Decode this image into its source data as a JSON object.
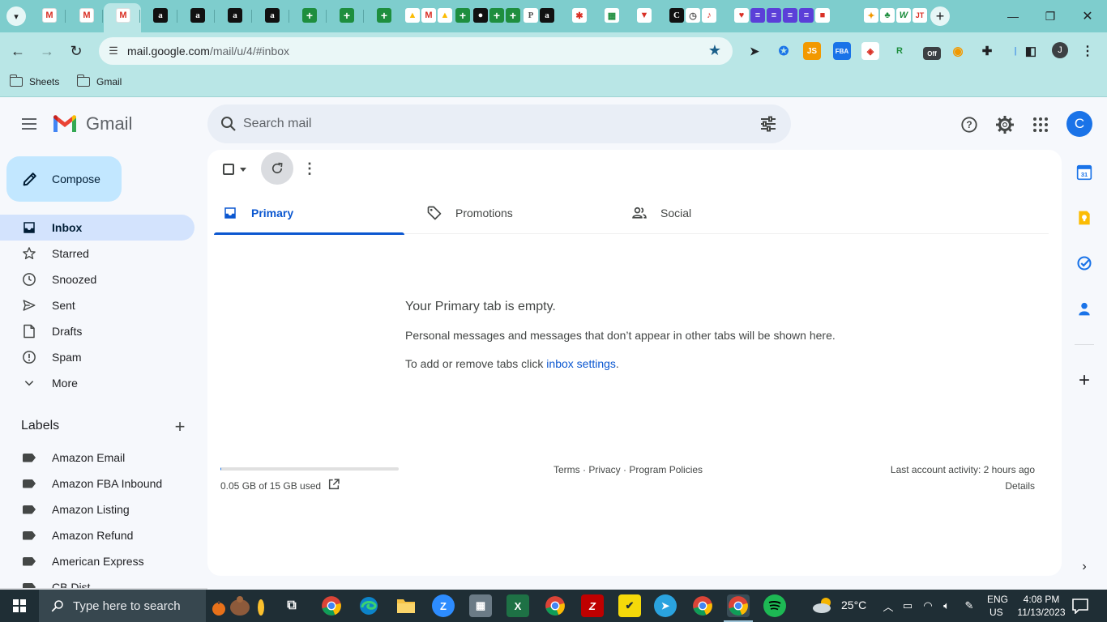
{
  "browser": {
    "url_host": "mail.google.com",
    "url_path": "/mail/u/4/#inbox",
    "tab_favicons": [
      {
        "glyph": "M",
        "kind": "gmail"
      },
      {
        "glyph": "M",
        "kind": "gmail"
      },
      {
        "glyph": "M",
        "kind": "gmail"
      },
      {
        "glyph": "a",
        "kind": "amazon"
      },
      {
        "glyph": "a",
        "kind": "amazon"
      },
      {
        "glyph": "a",
        "kind": "amazon"
      },
      {
        "glyph": "a",
        "kind": "amazon"
      },
      {
        "glyph": "+",
        "kind": "sheets"
      },
      {
        "glyph": "+",
        "kind": "sheets"
      },
      {
        "glyph": "+",
        "kind": "sheets"
      }
    ],
    "bookmarks": [
      "Sheets",
      "Gmail"
    ],
    "profile_initial": "J",
    "ext_off_label": "Off"
  },
  "gmail": {
    "logo_text": "Gmail",
    "search_placeholder": "Search mail",
    "avatar_initial": "C",
    "compose_label": "Compose",
    "nav": [
      {
        "label": "Inbox",
        "icon": "inbox-icon",
        "active": true
      },
      {
        "label": "Starred",
        "icon": "star-icon"
      },
      {
        "label": "Snoozed",
        "icon": "clock-icon"
      },
      {
        "label": "Sent",
        "icon": "send-icon"
      },
      {
        "label": "Drafts",
        "icon": "draft-icon"
      },
      {
        "label": "Spam",
        "icon": "spam-icon"
      },
      {
        "label": "More",
        "icon": "chevron-down-icon"
      }
    ],
    "labels_title": "Labels",
    "labels": [
      "Amazon Email",
      "Amazon FBA Inbound",
      "Amazon Listing",
      "Amazon Refund",
      "American Express",
      "CB Dist"
    ],
    "tabs": [
      {
        "label": "Primary",
        "icon": "inbox-icon",
        "active": true
      },
      {
        "label": "Promotions",
        "icon": "tag-icon"
      },
      {
        "label": "Social",
        "icon": "people-icon"
      }
    ],
    "empty": {
      "title": "Your Primary tab is empty.",
      "description": "Personal messages and messages that don’t appear in other tabs will be shown here.",
      "hint_prefix": "To add or remove tabs click ",
      "hint_link": "inbox settings",
      "hint_suffix": "."
    },
    "storage": {
      "text": "0.05 GB of 15 GB used",
      "used_fraction": 0.003
    },
    "footer": {
      "terms": "Terms",
      "privacy": "Privacy",
      "policies": "Program Policies",
      "separator": " · ",
      "activity": "Last account activity: 2 hours ago",
      "details": "Details"
    }
  },
  "taskbar": {
    "search_text": "Type here to search",
    "weather_temp": "25°C",
    "lang_top": "ENG",
    "lang_bottom": "US",
    "time": "4:08 PM",
    "date": "11/13/2023"
  }
}
